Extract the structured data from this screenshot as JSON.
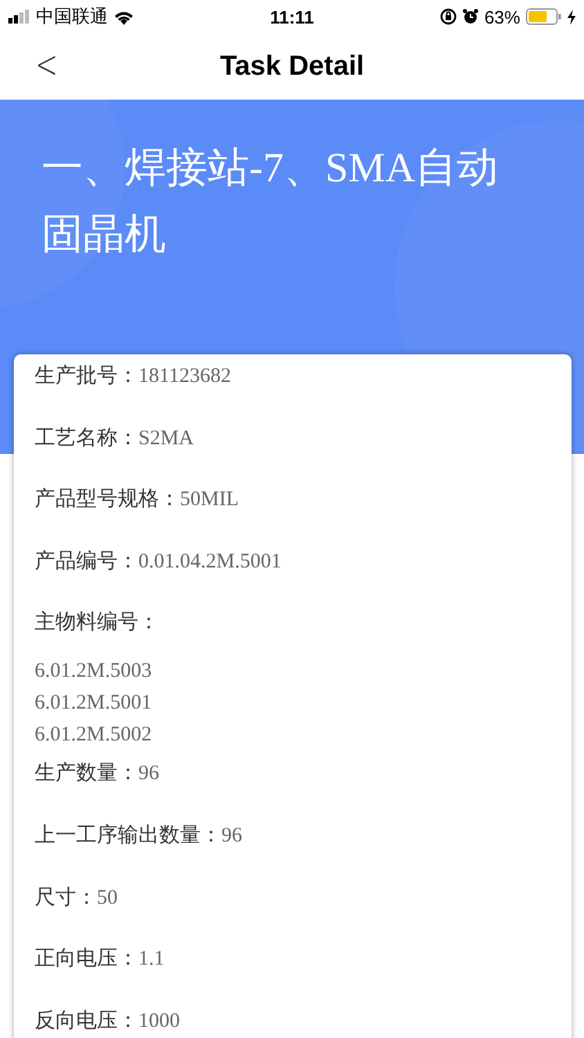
{
  "status_bar": {
    "carrier": "中国联通",
    "time": "11:11",
    "battery": "63%"
  },
  "nav": {
    "back": "<",
    "title": "Task Detail"
  },
  "header": {
    "title": "一、焊接站-7、SMA自动固晶机"
  },
  "fields": [
    {
      "kind": "text",
      "label": "生产批号：",
      "value": "181123682"
    },
    {
      "kind": "text",
      "label": "工艺名称：",
      "value": "S2MA"
    },
    {
      "kind": "text",
      "label": "产品型号规格：",
      "value": "50MIL"
    },
    {
      "kind": "text",
      "label": "产品编号：",
      "value": "0.01.04.2M.5001"
    },
    {
      "kind": "list",
      "label": "主物料编号：",
      "values": [
        "6.01.2M.5003",
        "6.01.2M.5001",
        "6.01.2M.5002"
      ]
    },
    {
      "kind": "text",
      "label": "生产数量：",
      "value": "96"
    },
    {
      "kind": "text",
      "label": "上一工序输出数量：",
      "value": "96"
    },
    {
      "kind": "text",
      "label": "尺寸：",
      "value": "50"
    },
    {
      "kind": "text",
      "label": "正向电压：",
      "value": "1.1"
    },
    {
      "kind": "text",
      "label": "反向电压：",
      "value": "1000"
    }
  ]
}
